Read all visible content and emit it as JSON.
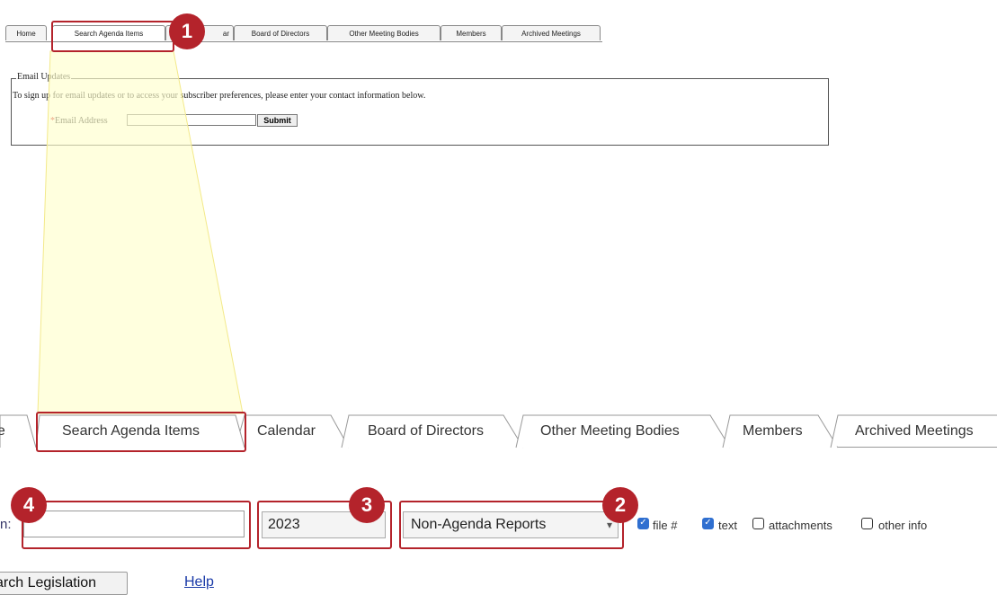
{
  "top_tabs": [
    "Home",
    "Search Agenda Items",
    "Calendar",
    "Board of Directors",
    "Other Meeting Bodies",
    "Members",
    "Archived Meetings"
  ],
  "top_tab_calendar_fragment": "ar",
  "email_section": {
    "legend": "Email Updates",
    "description": "To sign up for email updates or to access your subscriber preferences, please enter your contact information below.",
    "required_mark": "*",
    "email_label": "Email Address",
    "email_value": "",
    "submit_label": "Submit"
  },
  "big_tabs": [
    "Home",
    "Search Agenda Items",
    "Calendar",
    "Board of Directors",
    "Other Meeting Bodies",
    "Members",
    "Archived Meetings"
  ],
  "big_tab_home_fragment": "ne",
  "search_form": {
    "label_fragment": "n:",
    "keyword_value": "",
    "year_value": "2023",
    "type_value": "Non-Agenda Reports",
    "checkboxes": [
      {
        "label": "file #",
        "checked": true
      },
      {
        "label": "text",
        "checked": true
      },
      {
        "label": "attachments",
        "checked": false
      },
      {
        "label": "other info",
        "checked": false
      }
    ],
    "search_button_fragment": "arch Legislation",
    "help_link": "Help"
  },
  "callouts": [
    "1",
    "2",
    "3",
    "4"
  ],
  "colors": {
    "highlight": "#b4232b",
    "beam": "#ffffcc",
    "checkbox_checked": "#2f6fd0"
  }
}
